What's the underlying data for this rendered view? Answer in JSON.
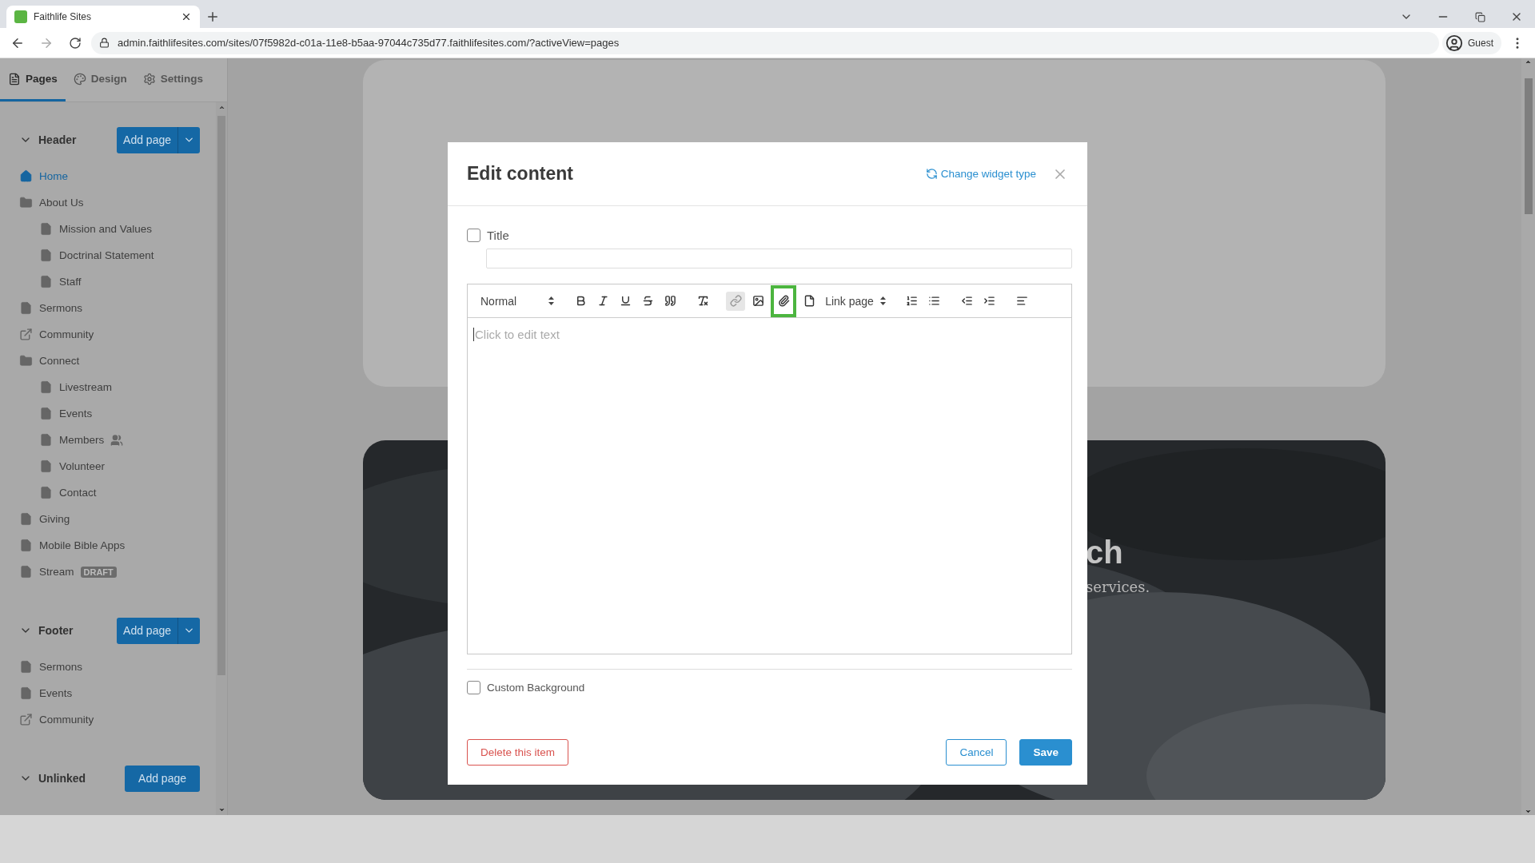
{
  "browser": {
    "tab_title": "Faithlife Sites",
    "url": "admin.faithlifesites.com/sites/07f5982d-c01a-11e8-b5aa-97044c735d77.faithlifesites.com/?activeView=pages",
    "profile": "Guest"
  },
  "sidebar": {
    "tabs": [
      {
        "label": "Pages",
        "selected": true
      },
      {
        "label": "Design",
        "selected": false
      },
      {
        "label": "Settings",
        "selected": false
      }
    ],
    "sections": [
      {
        "title": "Header",
        "expanded": true,
        "button": "Add page",
        "split": true,
        "items": [
          {
            "kind": "home",
            "label": "Home",
            "selected": true
          },
          {
            "kind": "folder",
            "label": "About Us",
            "selected": false,
            "children": [
              {
                "kind": "page",
                "label": "Mission and Values",
                "selected": false
              },
              {
                "kind": "page",
                "label": "Doctrinal Statement",
                "selected": false
              },
              {
                "kind": "page",
                "label": "Staff",
                "selected": false
              }
            ]
          },
          {
            "kind": "page",
            "label": "Sermons",
            "selected": false
          },
          {
            "kind": "external",
            "label": "Community",
            "selected": false
          },
          {
            "kind": "folder",
            "label": "Connect",
            "selected": false,
            "children": [
              {
                "kind": "page",
                "label": "Livestream",
                "selected": false
              },
              {
                "kind": "page",
                "label": "Events",
                "selected": false
              },
              {
                "kind": "page",
                "label": "Members",
                "selected": false,
                "restricted": true
              },
              {
                "kind": "page",
                "label": "Volunteer",
                "selected": false
              },
              {
                "kind": "page",
                "label": "Contact",
                "selected": false
              }
            ]
          },
          {
            "kind": "page",
            "label": "Giving",
            "selected": false
          },
          {
            "kind": "page",
            "label": "Mobile Bible Apps",
            "selected": false
          },
          {
            "kind": "page",
            "label": "Stream",
            "selected": false,
            "badge": "DRAFT"
          }
        ]
      },
      {
        "title": "Footer",
        "expanded": true,
        "button": "Add page",
        "split": true,
        "items": [
          {
            "kind": "page",
            "label": "Sermons",
            "selected": false
          },
          {
            "kind": "page",
            "label": "Events",
            "selected": false
          },
          {
            "kind": "external",
            "label": "Community",
            "selected": false
          }
        ]
      },
      {
        "title": "Unlinked",
        "expanded": true,
        "button": "Add page",
        "split": false
      }
    ]
  },
  "hero": {
    "heading": "ch",
    "subtext": "services."
  },
  "dialog": {
    "title": "Edit content",
    "change_link": "Change widget type",
    "title_field": {
      "label": "Title",
      "checked": false
    },
    "toolbar": [
      [
        {
          "kind": "select",
          "label": "Normal"
        }
      ],
      [
        {
          "kind": "button",
          "active": false,
          "highlighted": false
        },
        {
          "kind": "button",
          "active": false,
          "highlighted": false
        },
        {
          "kind": "button",
          "active": false,
          "highlighted": false
        },
        {
          "kind": "button",
          "active": false,
          "highlighted": false
        },
        {
          "kind": "button",
          "active": false,
          "highlighted": false
        }
      ],
      [
        {
          "kind": "button",
          "active": false,
          "highlighted": false
        }
      ],
      [
        {
          "kind": "button",
          "active": true,
          "highlighted": false
        },
        {
          "kind": "button",
          "active": false,
          "highlighted": false
        },
        {
          "kind": "button",
          "active": false,
          "highlighted": true
        },
        {
          "kind": "button",
          "active": false,
          "highlighted": false
        },
        {
          "kind": "select",
          "label": "Link page"
        }
      ],
      [
        {
          "kind": "button",
          "active": false,
          "highlighted": false
        },
        {
          "kind": "button",
          "active": false,
          "highlighted": false
        }
      ],
      [
        {
          "kind": "button",
          "active": false,
          "highlighted": false
        },
        {
          "kind": "button",
          "active": false,
          "highlighted": false
        }
      ],
      [
        {
          "kind": "button",
          "active": false,
          "highlighted": false
        }
      ]
    ],
    "editor": {
      "placeholder": "Click to edit text"
    },
    "background_field": {
      "label": "Custom Background",
      "checked": false
    },
    "buttons": [
      {
        "kind": "danger",
        "label": "Delete this item"
      },
      {
        "kind": "secondary",
        "label": "Cancel"
      },
      {
        "kind": "primary",
        "label": "Save"
      }
    ]
  }
}
